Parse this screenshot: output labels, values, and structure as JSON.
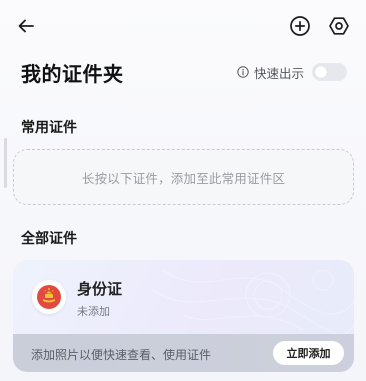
{
  "header": {
    "back_icon": "arrow-left-icon",
    "add_icon": "plus-circle-icon",
    "settings_icon": "hexagon-settings-icon",
    "title": "我的证件夹"
  },
  "quick_show": {
    "info_icon": "info-circle-icon",
    "label": "快速出示",
    "enabled": false
  },
  "common": {
    "title": "常用证件",
    "hint": "长按以下证件，添加至此常用证件区"
  },
  "all": {
    "title": "全部证件",
    "card": {
      "emblem_icon": "national-emblem-icon",
      "name": "身份证",
      "status": "未添加",
      "tip": "添加照片以便快速查看、使用证件",
      "button": "立即添加"
    }
  },
  "colors": {
    "emblem_red": "#e04a3f",
    "emblem_gold": "#f1c232",
    "card_bottom": "#cdd0dc"
  }
}
